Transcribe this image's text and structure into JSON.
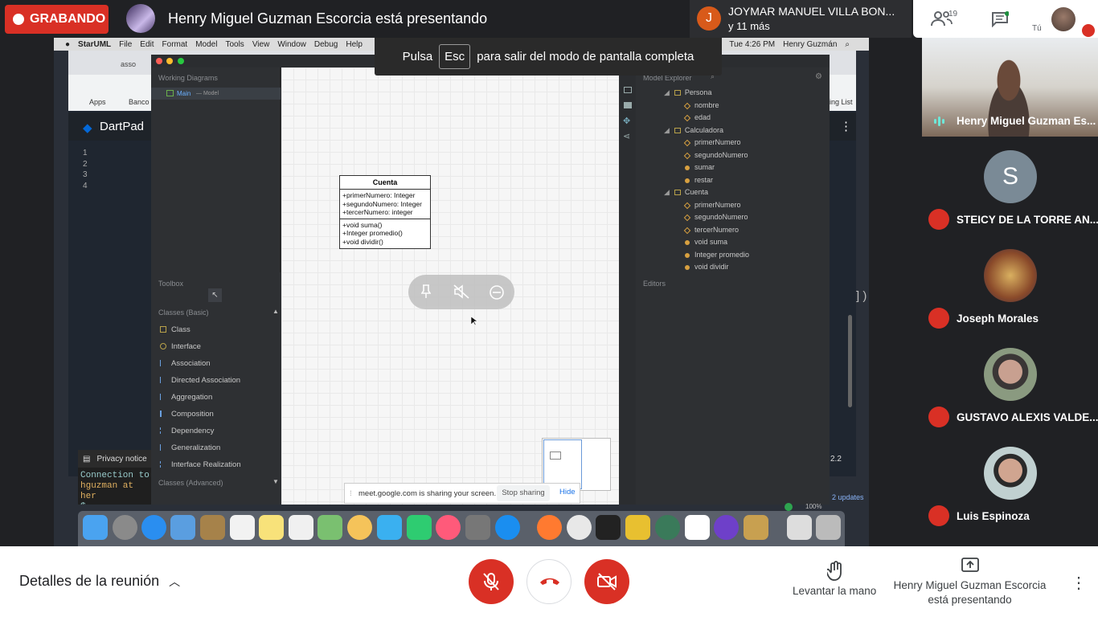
{
  "top": {
    "recording": "GRABANDO",
    "presenter_title": "Henry Miguel Guzman Escorcia está presentando",
    "speaker_initial": "J",
    "speaker_name": "JOYMAR MANUEL VILLA BON...",
    "speaker_more": "y 11 más",
    "participant_count": "19",
    "self_label": "Tú"
  },
  "shared_screen": {
    "menubar": [
      "StarUML",
      "File",
      "Edit",
      "Format",
      "Model",
      "Tools",
      "View",
      "Window",
      "Debug",
      "Help"
    ],
    "clock": "Tue 4:26 PM",
    "user": "Henry Guzmán",
    "fullscreen_banner": {
      "before": "Pulsa",
      "key": "Esc",
      "after": "para salir del modo de pantalla completa"
    },
    "chrome": {
      "tab": "asso",
      "bookmarks": [
        "Apps",
        "Banco"
      ],
      "reading_list": "ing List",
      "dartpad": "DartPad",
      "line_numbers": [
        "1",
        "2",
        "3",
        "4"
      ],
      "version": "2.2",
      "updates": "2 updates",
      "privacy": "Privacy notice",
      "paren": "] )"
    },
    "terminal": [
      "Connection to",
      "hguzman at her",
      "$ "
    ],
    "staruml": {
      "working_title": "Working Diagrams",
      "diagram_item": "Main",
      "diagram_sub": "— Model",
      "toolbox_title": "Toolbox",
      "toolbox_section": "Classes (Basic)",
      "toolbox_items": [
        "Class",
        "Interface",
        "Association",
        "Directed Association",
        "Aggregation",
        "Composition",
        "Dependency",
        "Generalization",
        "Interface Realization"
      ],
      "toolbox_section2": "Classes (Advanced)",
      "class_box": {
        "name": "Cuenta",
        "attributes": [
          "+primerNumero: Integer",
          "+segundoNumero: Integer",
          "+tercerNumero: integer"
        ],
        "operations": [
          "+void suma()",
          "+Integer promedio()",
          "+void dividir()"
        ]
      },
      "explorer_title": "Model Explorer",
      "explorer": [
        {
          "name": "Persona",
          "kind": "class"
        },
        {
          "name": "nombre",
          "kind": "attr"
        },
        {
          "name": "edad",
          "kind": "attr"
        },
        {
          "name": "Calculadora",
          "kind": "class"
        },
        {
          "name": "primerNumero",
          "kind": "attr"
        },
        {
          "name": "segundoNumero",
          "kind": "attr"
        },
        {
          "name": "sumar",
          "kind": "op"
        },
        {
          "name": "restar",
          "kind": "op"
        },
        {
          "name": "Cuenta",
          "kind": "class"
        },
        {
          "name": "primerNumero",
          "kind": "attr"
        },
        {
          "name": "segundoNumero",
          "kind": "attr"
        },
        {
          "name": "tercerNumero",
          "kind": "attr"
        },
        {
          "name": "void suma",
          "kind": "op"
        },
        {
          "name": "Integer promedio",
          "kind": "op"
        },
        {
          "name": "void dividir",
          "kind": "op"
        }
      ],
      "editors_title": "Editors",
      "zoom": "100%"
    },
    "share_bar": {
      "text": "meet.google.com is sharing your screen.",
      "stop": "Stop sharing",
      "hide": "Hide"
    }
  },
  "participants": {
    "presenter_tile_name": "Henry Miguel Guzman Es...",
    "list": [
      {
        "initial": "S",
        "name": "STEICY DE LA TORRE AN..."
      },
      {
        "initial": "",
        "name": "Joseph Morales"
      },
      {
        "initial": "",
        "name": "GUSTAVO ALEXIS VALDE..."
      },
      {
        "initial": "",
        "name": "Luis Espinoza"
      }
    ]
  },
  "bottom": {
    "details": "Detalles de la reunión",
    "raise_hand": "Levantar la mano",
    "presenting": "Henry Miguel Guzman Escorcia está presentando"
  },
  "colors": {
    "danger": "#d93025",
    "meet_bg": "#202124",
    "accent": "#1a73e8"
  }
}
